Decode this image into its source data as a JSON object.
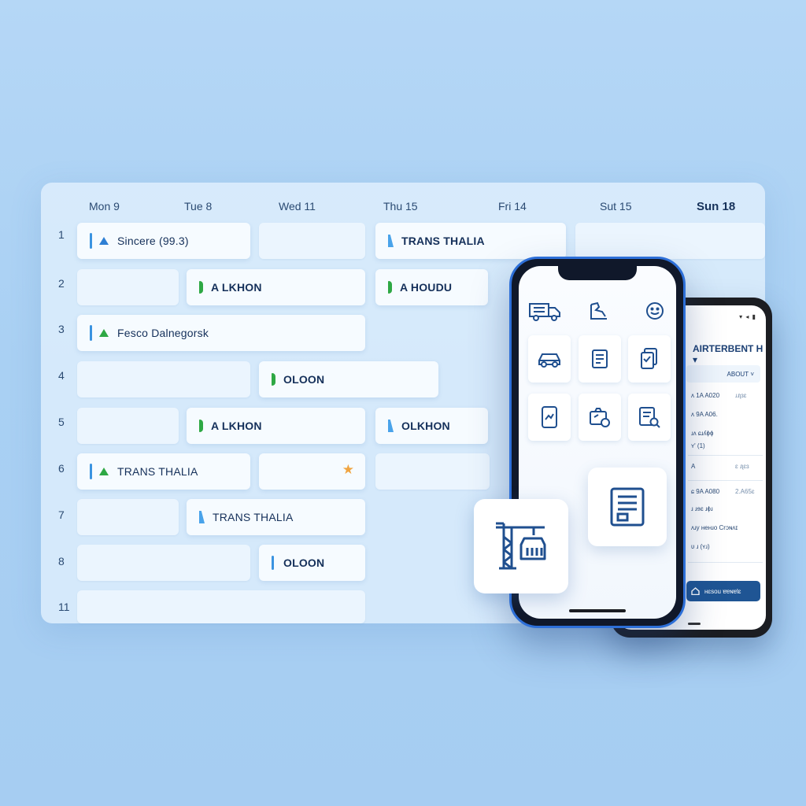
{
  "calendar": {
    "days": [
      "Mon 9",
      "Tue 8",
      "Wed 11",
      "Thu 15",
      "Fri 14",
      "Sut 15",
      "Sun 18"
    ],
    "rows": [
      "1",
      "2",
      "3",
      "4",
      "5",
      "6",
      "7",
      "8",
      "11"
    ],
    "events": {
      "e1": "Sincere (99.3)",
      "e2": "TRANS THALIA",
      "e3": "A LKHON",
      "e4": "A HOUDU",
      "e5": "Fesco Dalnegorsk",
      "e6": "OLOON",
      "e7": "A LKHON",
      "e8": "OLKHON",
      "e9": "TRANS THALIA",
      "e10": "TRANS THALIA",
      "e11": "OLOON"
    }
  },
  "android": {
    "status": "▾ ◂ ▮",
    "title": "AIRTERBENT H",
    "dropdown": "ABOUT",
    "rows": [
      {
        "l": "ʌ 1A A020",
        "r": "ɹɹʅɜɛ"
      },
      {
        "l": "ʌ 9A A06.",
        "r": ""
      },
      {
        "l": "ɹʌ ɕɹʎɸɸ",
        "r": ""
      },
      {
        "l": "ʏ' (1)",
        "r": ""
      },
      {
        "l": "A",
        "r": "ɛ ɹʅɛɜ"
      },
      {
        "l": "ɕ 9A A080",
        "r": "2.A65ɛ"
      },
      {
        "l": "ɹ ɹɘɛ ɹɸɹ",
        "r": ""
      },
      {
        "l": "ʌɹy ʜeʜɹo Crɔɴʌɪ",
        "r": ""
      },
      {
        "l": "ʋ ɹ (ʏɹ)",
        "r": ""
      }
    ],
    "button": "ʜɛsou ɐɐɴɐlɛ"
  },
  "colors": {
    "accent": "#2e7fd4",
    "green": "#2ea844",
    "star": "#f0a441",
    "phone_frame": "#2d6fd8",
    "button": "#1f5594"
  },
  "icons": [
    "truck-icon",
    "map-icon",
    "smile-icon",
    "car-icon",
    "document-icon",
    "clipboard-icon",
    "tablet-chart-icon",
    "camera-box-icon",
    "search-document-icon",
    "checklist-icon",
    "port-crane-icon",
    "star-icon",
    "home-icon"
  ]
}
